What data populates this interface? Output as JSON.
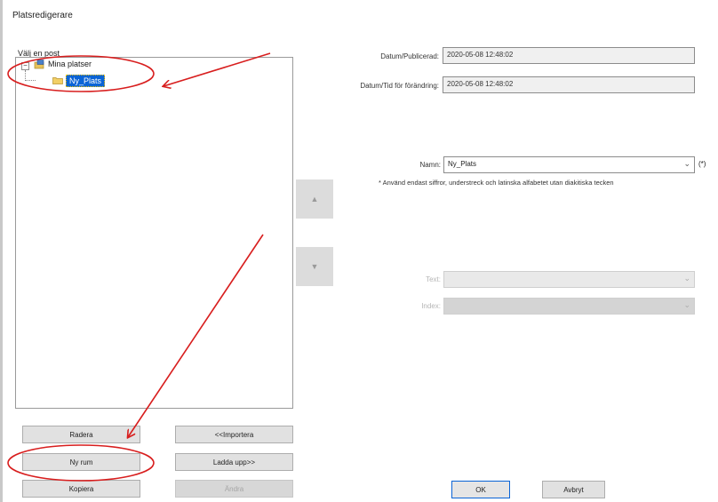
{
  "window": {
    "title": "Platsredigerare"
  },
  "tree": {
    "group_label": "Välj en post",
    "root": {
      "label": "Mina platser",
      "icon": "computer-folder-icon",
      "expander": "−"
    },
    "child": {
      "label": "Ny_Plats",
      "icon": "folder-icon"
    }
  },
  "arrows": {
    "up": "▲",
    "down": "▼"
  },
  "fields": {
    "published_label": "Datum/Publicerad:",
    "published_value": "2020-05-08 12:48:02",
    "modified_label": "Datum/Tid för förändring:",
    "modified_value": "2020-05-08 12:48:02",
    "name_label": "Namn:",
    "name_value": "Ny_Plats",
    "name_required": "(*)",
    "name_note": "* Använd endast siffror, understreck och latinska alfabetet utan diakitiska tecken",
    "text_label": "Text:",
    "text_value": "",
    "index_label": "Index:",
    "index_value": ""
  },
  "buttons": {
    "delete": "Radera",
    "import": "<<Importera",
    "new": "Ny rum",
    "upload": "Ladda upp>>",
    "copy": "Kopiera",
    "disabled_btn": "Ändra",
    "ok": "OK",
    "cancel": "Avbryt"
  },
  "colors": {
    "annotation": "#d81e1e",
    "selection": "#0a64d6"
  }
}
